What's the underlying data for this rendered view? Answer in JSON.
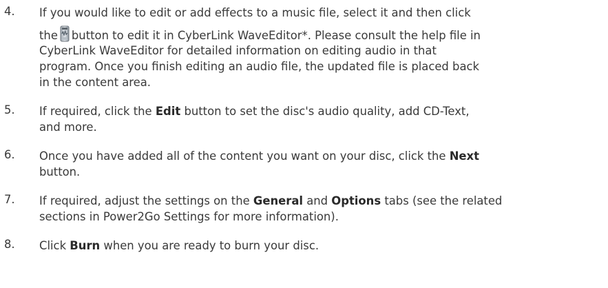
{
  "steps": [
    {
      "number": "4.",
      "line1": "If you would like to edit or add effects to a music file, select it and then click",
      "pre_icon": "the",
      "icon_name": "wave-editor-icon",
      "post_icon": "button to edit it in CyberLink WaveEditor*. Please consult the help file in",
      "line3": "CyberLink WaveEditor for detailed information on editing audio in that",
      "line4": "program. Once you finish editing an audio file, the updated file is placed back",
      "line5": "in the content area."
    },
    {
      "number": "5.",
      "pre": "If required, click the ",
      "bold": "Edit",
      "post": " button to set the disc's audio quality, add CD-Text,",
      "line2": "and more."
    },
    {
      "number": "6.",
      "pre": "Once you have added all of the content you want on your disc, click the ",
      "bold": "Next",
      "line2": "button."
    },
    {
      "number": "7.",
      "pre": "If required, adjust the settings on the ",
      "bold1": "General",
      "mid": " and ",
      "bold2": "Options",
      "post": " tabs (see the related",
      "line2": "sections in Power2Go Settings for more information)."
    },
    {
      "number": "8.",
      "pre": "Click ",
      "bold": "Burn",
      "post": " when you are ready to burn your disc."
    }
  ]
}
